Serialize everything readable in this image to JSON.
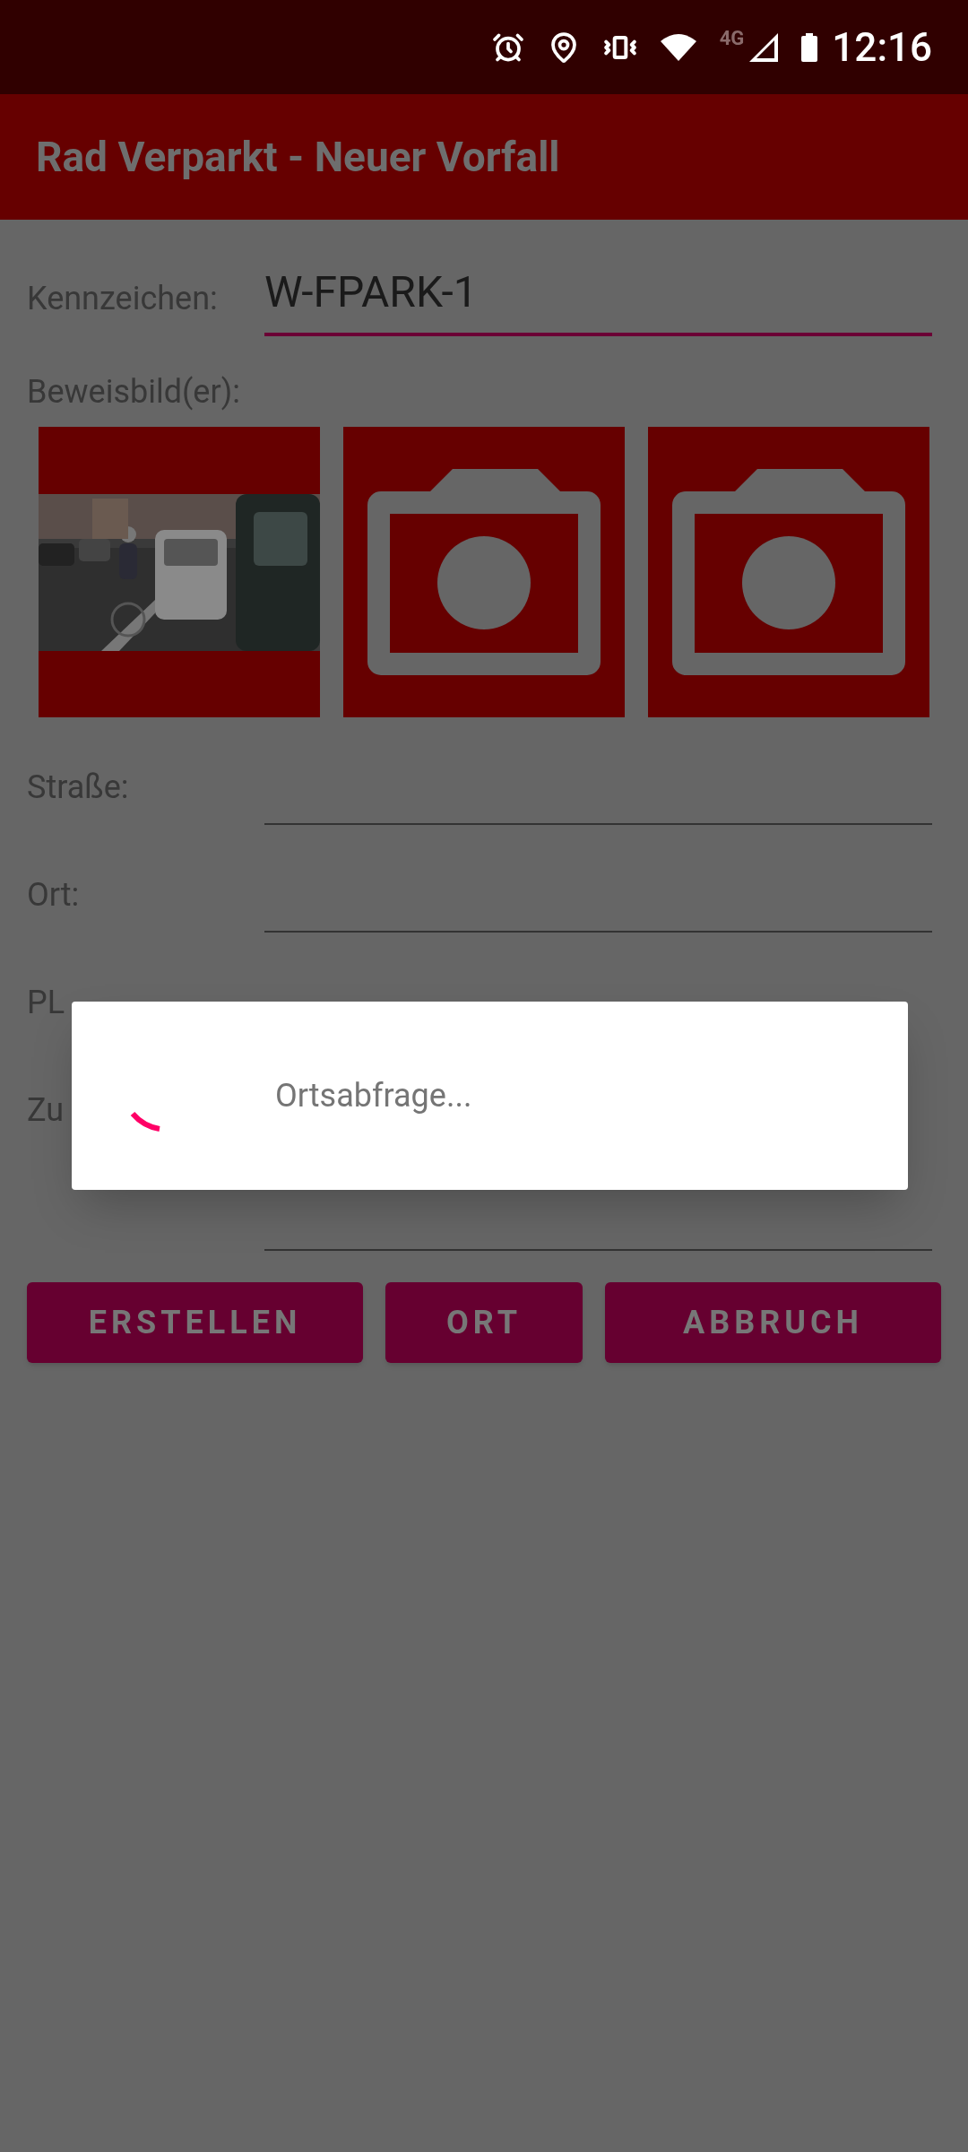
{
  "status_bar": {
    "network": "4G",
    "time": "12:16"
  },
  "app_bar": {
    "title": "Rad Verparkt - Neuer Vorfall"
  },
  "fields": [
    {
      "kind": "text",
      "label": "Kennzeichen:",
      "value": "W-FPARK-1",
      "focused": true
    },
    {
      "kind": "section",
      "label": "Beweisbild(er):"
    },
    {
      "kind": "photos",
      "photos": [
        {
          "kind": "picture"
        },
        {
          "kind": "empty"
        },
        {
          "kind": "empty"
        }
      ]
    },
    {
      "kind": "text",
      "label": "Straße:",
      "focused": false
    },
    {
      "kind": "text",
      "label": "Ort:",
      "focused": false
    },
    {
      "kind": "covered",
      "label": "PL"
    },
    {
      "kind": "multiline",
      "label": "Zu",
      "focused": false
    }
  ],
  "buttons": [
    "ERSTELLEN",
    "ORT",
    "ABBRUCH"
  ],
  "dialog": {
    "kind": "progress",
    "message": "Ortsabfrage..."
  }
}
